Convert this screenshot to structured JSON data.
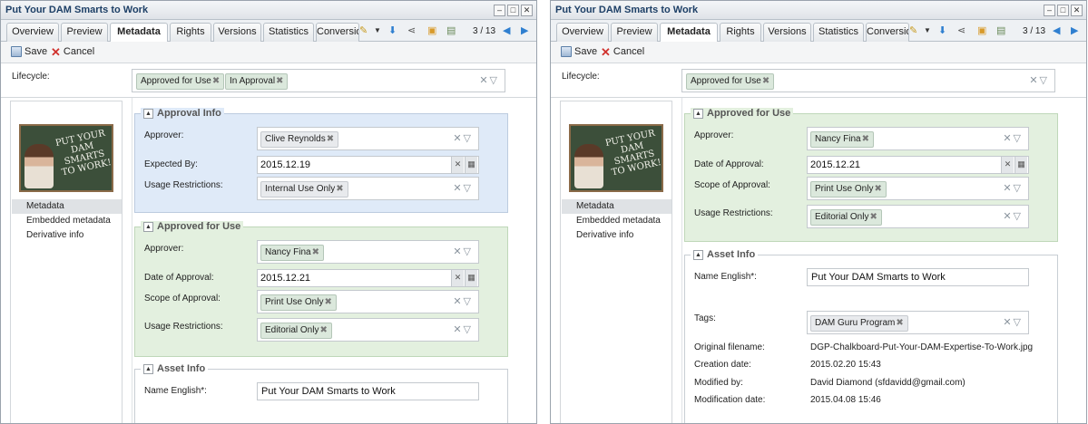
{
  "window": {
    "title": "Put Your DAM Smarts to Work"
  },
  "tabs": [
    "Overview",
    "Preview",
    "Metadata",
    "Rights",
    "Versions",
    "Statistics",
    "Conversions"
  ],
  "active_tab": "Metadata",
  "counter": "3 / 13",
  "toolbar": {
    "save_label": "Save",
    "cancel_label": "Cancel"
  },
  "lifecycle": {
    "label": "Lifecycle:"
  },
  "thumbnail": {
    "text": "PUT YOUR DAM SMARTS TO WORK!"
  },
  "nav": {
    "items": [
      "Metadata",
      "Embedded metadata",
      "Derivative info"
    ],
    "selected": "Metadata"
  },
  "left_window": {
    "lifecycle_chips": [
      "Approved for Use",
      "In Approval"
    ],
    "approval_info": {
      "title": "Approval Info",
      "approver_label": "Approver:",
      "approver": "Clive Reynolds",
      "expected_label": "Expected By:",
      "expected": "2015.12.19",
      "usage_label": "Usage Restrictions:",
      "usage": "Internal Use Only"
    },
    "approved_for_use": {
      "title": "Approved for Use",
      "approver_label": "Approver:",
      "approver": "Nancy Fina",
      "date_label": "Date of Approval:",
      "date": "2015.12.21",
      "scope_label": "Scope of Approval:",
      "scope": "Print Use Only",
      "usage_label": "Usage Restrictions:",
      "usage": "Editorial Only"
    },
    "asset_info": {
      "title": "Asset Info",
      "name_label": "Name English*:",
      "name": "Put Your DAM Smarts to Work"
    }
  },
  "right_window": {
    "lifecycle_chips": [
      "Approved for Use"
    ],
    "approved_for_use": {
      "title": "Approved for Use",
      "approver_label": "Approver:",
      "approver": "Nancy Fina",
      "date_label": "Date of Approval:",
      "date": "2015.12.21",
      "scope_label": "Scope of Approval:",
      "scope": "Print Use Only",
      "usage_label": "Usage Restrictions:",
      "usage": "Editorial Only"
    },
    "asset_info": {
      "title": "Asset Info",
      "name_label": "Name English*:",
      "name": "Put Your DAM Smarts to Work",
      "tags_label": "Tags:",
      "tags": [
        "DAM Guru Program"
      ],
      "filename_label": "Original filename:",
      "filename": "DGP-Chalkboard-Put-Your-DAM-Expertise-To-Work.jpg",
      "created_label": "Creation date:",
      "created": "2015.02.20 15:43",
      "modified_by_label": "Modified by:",
      "modified_by": "David Diamond (sfdavidd@gmail.com)",
      "modified_label": "Modification date:",
      "modified": "2015.04.08 15:46"
    }
  }
}
